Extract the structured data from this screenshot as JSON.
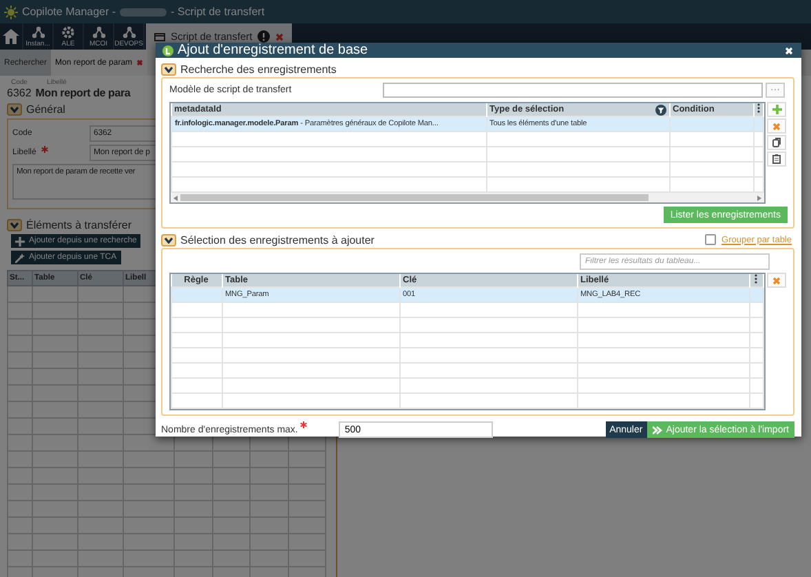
{
  "app": {
    "title_prefix": "Copilote Manager -",
    "title_suffix": "- Script de transfert"
  },
  "toolbar": {
    "items": [
      {
        "kind": "home"
      },
      {
        "kind": "network",
        "label": "Instan..."
      },
      {
        "kind": "gear",
        "label": "ALE"
      },
      {
        "kind": "network",
        "label": "MCOI"
      },
      {
        "kind": "network",
        "label": "DEVOPS"
      }
    ],
    "open_tab": {
      "label": "Script de transfert"
    }
  },
  "subtabs": [
    {
      "label": "Rechercher",
      "selected": false,
      "closable": false
    },
    {
      "label": "Mon report de param",
      "selected": true,
      "closable": true
    }
  ],
  "record": {
    "code_caption": "Code",
    "label_caption": "Libellé",
    "code": "6362",
    "title": "Mon report de para"
  },
  "general": {
    "title": "Général",
    "expanded": true,
    "fields": [
      {
        "label": "Code",
        "required": false,
        "value": "6362"
      },
      {
        "label": "Libellé",
        "required": true,
        "value": "Mon report de p"
      }
    ],
    "description": "Mon report de param de recette ver"
  },
  "elements": {
    "title": "Éléments à transférer",
    "expanded": true,
    "buttons": [
      {
        "kind": "add",
        "label": "Ajouter depuis une recherche"
      },
      {
        "kind": "wand",
        "label": "Ajouter depuis une TCA"
      }
    ],
    "columns": [
      "St...",
      "Table",
      "Clé",
      "Libell"
    ]
  },
  "dialog": {
    "title": "Ajout d'enregistrement de base",
    "search_section": {
      "title": "Recherche des enregistrements",
      "expanded": true,
      "model_label": "Modèle de script de transfert",
      "more_button": "···",
      "columns": [
        "metadataId",
        "Type de sélection",
        "Condition"
      ],
      "rows": [
        {
          "metadata_id": "**fr.infologic.manager.modele.Param** - Paramètres généraux de Copilote Man...",
          "selection_type": "Tous les éléments d'une table",
          "selected": true
        }
      ],
      "list_button": "Lister les enregistrements"
    },
    "selection_section": {
      "title": "Sélection des enregistrements à ajouter",
      "expanded": true,
      "group_by_table": {
        "label": "Grouper par table",
        "checked": false
      },
      "filter_placeholder": "Filtrer les résultats du tableau...",
      "columns": [
        "Règle",
        "Table",
        "Clé",
        "Libellé"
      ],
      "rows": [
        {
          "table": "MNG_Param",
          "key": "001",
          "label": "MNG_LAB4_REC",
          "selected": true
        }
      ]
    },
    "max_label": "Nombre d'enregistrements max.",
    "max_required": true,
    "max_value": "500",
    "buttons": [
      {
        "kind": "cancel",
        "label": "Annuler"
      },
      {
        "kind": "confirm",
        "label": "Ajouter la sélection à l'import"
      }
    ]
  }
}
